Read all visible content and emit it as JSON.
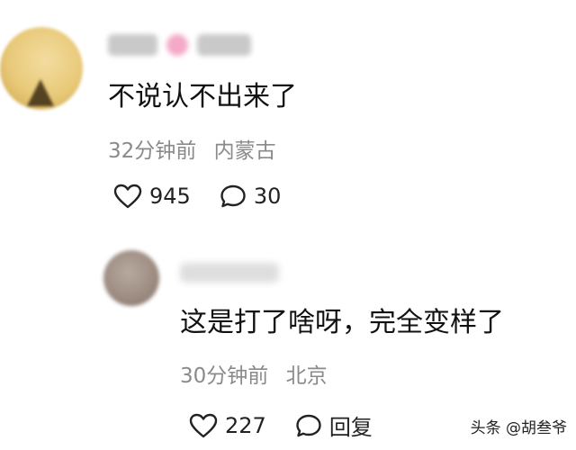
{
  "comments": [
    {
      "text": "不说认不出来了",
      "time": "32分钟前",
      "location": "内蒙古",
      "likes": "945",
      "replies": "30"
    },
    {
      "text": "这是打了啥呀，完全变样了",
      "time": "30分钟前",
      "location": "北京",
      "likes": "227",
      "reply_label": "回复"
    }
  ],
  "watermark": "头条 @胡叁爷",
  "icons": {
    "like": "heart-outline-icon",
    "comment": "speech-bubble-icon"
  },
  "colors": {
    "meta_text": "#8a8a8a",
    "body_text": "#111111"
  }
}
